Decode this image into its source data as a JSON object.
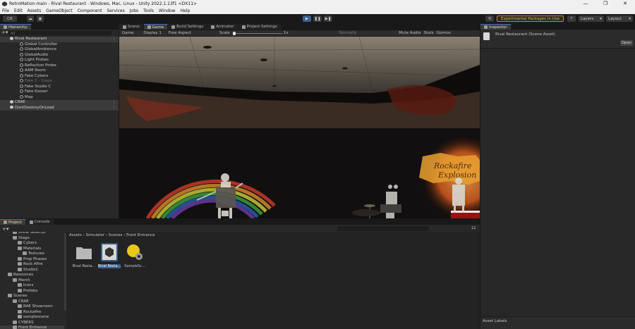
{
  "window": {
    "title": "RetroMation-main - Rival Restaurant - Windows, Mac, Linux - Unity 2022.1.13f1 <DX11>",
    "controls": [
      "—",
      "❐",
      "✕"
    ]
  },
  "menu": [
    "File",
    "Edit",
    "Assets",
    "GameObject",
    "Component",
    "Services",
    "Jobs",
    "Tools",
    "Window",
    "Help"
  ],
  "toolbar": {
    "account": "CR",
    "experimental": "Experimental Packages In Use",
    "layers": "Layers",
    "layout": "Layout"
  },
  "hierarchy": {
    "tab": "Hierarchy",
    "search_placeholder": "All",
    "rows": [
      {
        "label": "Rival Restaurant",
        "type": "scene",
        "indent": 0
      },
      {
        "label": "Global Controller",
        "type": "obj",
        "indent": 1
      },
      {
        "label": "GlobalAmbience",
        "type": "obj",
        "indent": 1
      },
      {
        "label": "GlobalAudio",
        "type": "obj",
        "indent": 1
      },
      {
        "label": "Light Probes",
        "type": "obj",
        "indent": 1
      },
      {
        "label": "Reflection Probe",
        "type": "obj",
        "indent": 1
      },
      {
        "label": "AAM Room",
        "type": "obj",
        "indent": 1
      },
      {
        "label": "Fake Cybers",
        "type": "obj",
        "indent": 1
      },
      {
        "label": "Fake 3 - Stage",
        "type": "dim",
        "indent": 1
      },
      {
        "label": "Fake Studio C",
        "type": "obj",
        "indent": 1
      },
      {
        "label": "Fake Kooser",
        "type": "obj",
        "indent": 1
      },
      {
        "label": "Map",
        "type": "obj",
        "indent": 1
      },
      {
        "label": "CRAE",
        "type": "scene",
        "indent": 0
      },
      {
        "label": "DontDestroyOnLoad",
        "type": "scene",
        "indent": 0
      }
    ]
  },
  "center_tabs": [
    {
      "label": "Scene",
      "active": false
    },
    {
      "label": "Game",
      "active": true
    },
    {
      "label": "Build Settings",
      "active": false
    },
    {
      "label": "Animator",
      "active": false
    },
    {
      "label": "Project Settings",
      "active": false
    }
  ],
  "game_bar": {
    "mode": "Game",
    "display": "Display 1",
    "aspect": "Free Aspect",
    "scale_label": "Scale",
    "scale_value": "1x",
    "quality": "Normally",
    "mute": "Mute Audio",
    "stats": "Stats",
    "gizmos": "Gizmos"
  },
  "sign": {
    "line1": "Rockafire",
    "line2": "Explosion"
  },
  "inspector": {
    "tab": "Inspector",
    "asset_title": "Rival Restaurant (Scene Asset)",
    "open_button": "Open",
    "asset_labels": "Asset Labels"
  },
  "project": {
    "tabs": [
      {
        "label": "Project",
        "active": true
      },
      {
        "label": "Console",
        "active": false
      }
    ],
    "count": "12",
    "breadcrumb": "Assets › Simulator › Scenes › Front Entrance",
    "tree": [
      {
        "label": "Show Selector",
        "indent": 2
      },
      {
        "label": "Stage",
        "indent": 2
      },
      {
        "label": "Cybers",
        "indent": 3
      },
      {
        "label": "Materials",
        "indent": 3
      },
      {
        "label": "Textures",
        "indent": 4
      },
      {
        "label": "Prop Phases",
        "indent": 3
      },
      {
        "label": "Rock Afire",
        "indent": 3
      },
      {
        "label": "StudioC",
        "indent": 3
      },
      {
        "label": "Resources",
        "indent": 1
      },
      {
        "label": "Merch",
        "indent": 2
      },
      {
        "label": "Icons",
        "indent": 3
      },
      {
        "label": "Prefabs",
        "indent": 3
      },
      {
        "label": "Scenes",
        "indent": 1
      },
      {
        "label": "CRAE",
        "indent": 2
      },
      {
        "label": "RAE Showroom",
        "indent": 3
      },
      {
        "label": "Rockafire",
        "indent": 3
      },
      {
        "label": "samplescene",
        "indent": 3
      },
      {
        "label": "CYBERS",
        "indent": 2
      },
      {
        "label": "Front Entrance",
        "indent": 2
      }
    ],
    "assets": [
      {
        "name": "Rival Resta...",
        "kind": "folder",
        "icon": "folder-icon"
      },
      {
        "name": "Rival Resta...",
        "kind": "scene",
        "icon": "unity-scene-icon"
      },
      {
        "name": "SampleSc...",
        "kind": "settings",
        "icon": "lighting-settings-icon"
      }
    ]
  }
}
